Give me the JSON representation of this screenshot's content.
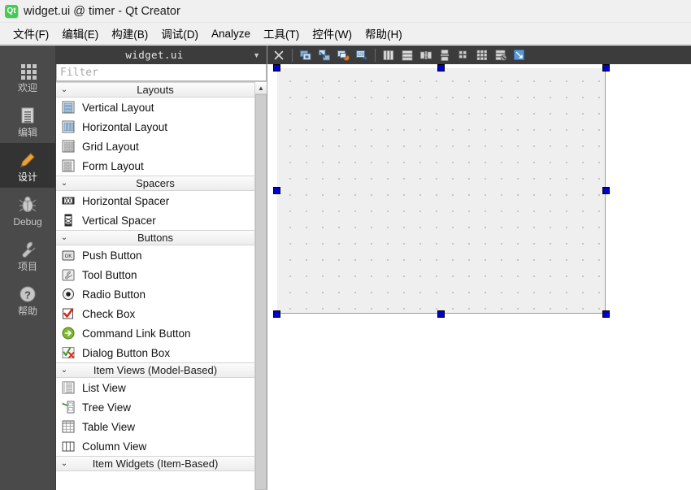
{
  "window": {
    "title": "widget.ui @ timer - Qt Creator",
    "logo_icon": "qt-logo-icon"
  },
  "menubar": {
    "items": [
      {
        "label": "文件(F)",
        "name": "menu-file"
      },
      {
        "label": "编辑(E)",
        "name": "menu-edit"
      },
      {
        "label": "构建(B)",
        "name": "menu-build"
      },
      {
        "label": "调试(D)",
        "name": "menu-debug"
      },
      {
        "label": "Analyze",
        "name": "menu-analyze"
      },
      {
        "label": "工具(T)",
        "name": "menu-tools"
      },
      {
        "label": "控件(W)",
        "name": "menu-window"
      },
      {
        "label": "帮助(H)",
        "name": "menu-help"
      }
    ]
  },
  "modebar": {
    "items": [
      {
        "label": "欢迎",
        "icon": "grid-icon",
        "active": false
      },
      {
        "label": "编辑",
        "icon": "document-icon",
        "active": false
      },
      {
        "label": "设计",
        "icon": "pencil-icon",
        "active": true
      },
      {
        "label": "Debug",
        "icon": "bug-icon",
        "active": false
      },
      {
        "label": "项目",
        "icon": "wrench-icon",
        "active": false
      },
      {
        "label": "帮助",
        "icon": "question-mark-icon",
        "active": false
      }
    ]
  },
  "widgetbox": {
    "tab_label": "widget.ui",
    "dropdown_icon": "chevron-down-icon",
    "close_icon": "close-icon",
    "filter": {
      "value": "",
      "placeholder": "Filter"
    },
    "scrollbar_up_icon": "chevron-up-icon",
    "categories": [
      {
        "title": "Layouts",
        "expanded": true,
        "items": [
          {
            "label": "Vertical Layout",
            "icon": "vertical-layout-icon"
          },
          {
            "label": "Horizontal Layout",
            "icon": "horizontal-layout-icon"
          },
          {
            "label": "Grid Layout",
            "icon": "grid-layout-icon"
          },
          {
            "label": "Form Layout",
            "icon": "form-layout-icon"
          }
        ]
      },
      {
        "title": "Spacers",
        "expanded": true,
        "items": [
          {
            "label": "Horizontal Spacer",
            "icon": "horizontal-spacer-icon"
          },
          {
            "label": "Vertical Spacer",
            "icon": "vertical-spacer-icon"
          }
        ]
      },
      {
        "title": "Buttons",
        "expanded": true,
        "items": [
          {
            "label": "Push Button",
            "icon": "push-button-icon"
          },
          {
            "label": "Tool Button",
            "icon": "tool-button-icon"
          },
          {
            "label": "Radio Button",
            "icon": "radio-button-icon"
          },
          {
            "label": "Check Box",
            "icon": "check-box-icon"
          },
          {
            "label": "Command Link Button",
            "icon": "command-link-button-icon"
          },
          {
            "label": "Dialog Button Box",
            "icon": "dialog-button-box-icon"
          }
        ]
      },
      {
        "title": "Item Views (Model-Based)",
        "expanded": true,
        "items": [
          {
            "label": "List View",
            "icon": "list-view-icon"
          },
          {
            "label": "Tree View",
            "icon": "tree-view-icon"
          },
          {
            "label": "Table View",
            "icon": "table-view-icon"
          },
          {
            "label": "Column View",
            "icon": "column-view-icon"
          }
        ]
      },
      {
        "title": "Item Widgets (Item-Based)",
        "expanded": true,
        "items": []
      }
    ]
  },
  "form_toolbar": {
    "buttons": [
      {
        "name": "close-form-button",
        "icon": "close-icon"
      },
      {
        "name": "edit-widgets-button",
        "icon": "edit-widgets-icon"
      },
      {
        "name": "edit-signals-slots-button",
        "icon": "edit-signals-slots-icon"
      },
      {
        "name": "edit-buddies-button",
        "icon": "edit-buddies-icon"
      },
      {
        "name": "edit-tab-order-button",
        "icon": "edit-tab-order-icon"
      },
      {
        "name": "layout-horizontally-button",
        "icon": "layout-horizontal-icon"
      },
      {
        "name": "layout-vertically-button",
        "icon": "layout-vertical-icon"
      },
      {
        "name": "layout-horizontal-splitter-button",
        "icon": "splitter-horizontal-icon"
      },
      {
        "name": "layout-vertical-splitter-button",
        "icon": "splitter-vertical-icon"
      },
      {
        "name": "layout-form-button",
        "icon": "form-layout-icon"
      },
      {
        "name": "layout-grid-button",
        "icon": "grid-layout-icon"
      },
      {
        "name": "break-layout-button",
        "icon": "break-layout-icon"
      },
      {
        "name": "adjust-size-button",
        "icon": "adjust-size-icon"
      }
    ]
  },
  "canvas": {
    "selected": true,
    "handle_color": "#0000cd",
    "grid_color": "#b9b9b9",
    "background": "#efefef"
  }
}
